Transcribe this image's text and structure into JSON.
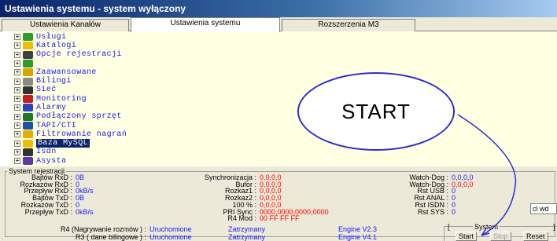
{
  "window": {
    "title": "Ustawienia systemu - system wyłączony"
  },
  "tabs": [
    {
      "label": "Ustawienia Kanałów",
      "active": false
    },
    {
      "label": "Ustawienia systemu",
      "active": true
    },
    {
      "label": "Rozszerzenia M3",
      "active": false
    }
  ],
  "tree": {
    "items": [
      {
        "label": "Usługi",
        "icon": "people-icon",
        "color": "#2e9b2e"
      },
      {
        "label": "Katalogi",
        "icon": "folder-icon",
        "color": "#e8c000"
      },
      {
        "label": "Opcje rejestracji",
        "icon": "recorder-icon",
        "color": "#404040"
      },
      {
        "label": "",
        "icon": "people-icon",
        "color": "#2e9b2e"
      },
      {
        "label": "Zaawansowane",
        "icon": "key-icon",
        "color": "#d6a500"
      },
      {
        "label": "Bilingi",
        "icon": "document-icon",
        "color": "#8a8a8a"
      },
      {
        "label": "Sieć",
        "icon": "network-icon",
        "color": "#333333"
      },
      {
        "label": "Monitoring",
        "icon": "monitor-icon",
        "color": "#c02020"
      },
      {
        "label": "Alarmy",
        "icon": "alarm-icon",
        "color": "#3040c0"
      },
      {
        "label": "Podłączony sprzęt",
        "icon": "hardware-icon",
        "color": "#1f7a1f"
      },
      {
        "label": "TAPI/CTI",
        "icon": "phone-icon",
        "color": "#2050a0"
      },
      {
        "label": "Filtrowanie nagrań",
        "icon": "filter-icon",
        "color": "#e0b000"
      },
      {
        "label": "Baza MySQL",
        "icon": "database-icon",
        "color": "#e8c000",
        "selected": true
      },
      {
        "label": "Isdn",
        "icon": "isdn-icon",
        "color": "#333333"
      },
      {
        "label": "Asysta",
        "icon": "assist-icon",
        "color": "#5a3aa0"
      }
    ]
  },
  "callout": {
    "text": "START"
  },
  "status": {
    "group_title": "System rejestracji",
    "col1": [
      {
        "label": "Bajtów RxD :",
        "value": "0B"
      },
      {
        "label": "Rozkazów RxD :",
        "value": "0"
      },
      {
        "label": "Przepływ RxD :",
        "value": "0kB/s"
      },
      {
        "label": "Bajtów TxD :",
        "value": "0B"
      },
      {
        "label": "Rozkazów TxD :",
        "value": "0"
      },
      {
        "label": "Przepływ TxD :",
        "value": "0kB/s"
      }
    ],
    "col2": [
      {
        "label": "Synchronizacja :",
        "value": "0,0,0,0"
      },
      {
        "label": "Bufor :",
        "value": "0,0,0,0"
      },
      {
        "label": "Rozkaz1 :",
        "value": "0,0,0,0"
      },
      {
        "label": "Rozkaz2 :",
        "value": "0,0,0,0"
      },
      {
        "label": "100 % :",
        "value": "0,0,0,0"
      },
      {
        "label": "PRI Sync :",
        "value": "0000,0000,0000,0000"
      },
      {
        "label": "R4 Mod :",
        "value": "00 FF FF FF"
      }
    ],
    "col3": [
      {
        "label": "Watch-Dog :",
        "value": "0,0,0,0",
        "color": "#1a1aff"
      },
      {
        "label": "Watch-Dog :",
        "value": "0,0,0,0",
        "color": "#ff0000"
      },
      {
        "label": "Rst USB :",
        "value": "0",
        "color": "#1a1aff"
      },
      {
        "label": "Rst ANAL :",
        "value": "0",
        "color": "#1a1aff"
      },
      {
        "label": "Rst ISDN :",
        "value": "0",
        "color": "#1a1aff"
      },
      {
        "label": "Rst SYS :",
        "value": "0",
        "color": "#1a1aff"
      }
    ],
    "small_field": "cl wd",
    "bottom_rows": [
      {
        "label": "R4 (Nagrywanie rozmów ) :",
        "status": "Uruchomione",
        "action": "Zatrzymany",
        "engine": "Engine V2.3"
      },
      {
        "label": "R3 ( dane bilingowe ) :",
        "status": "Uruchomione",
        "action": "Zatrzymany",
        "engine": "Engine V4.1"
      }
    ],
    "system_frame": {
      "title": "System",
      "bracket_left": "[",
      "bracket_right": "]",
      "buttons": [
        {
          "label": "Start",
          "disabled": false
        },
        {
          "label": "Stop",
          "disabled": true
        },
        {
          "label": "Reset",
          "disabled": false
        }
      ]
    }
  },
  "colors": {
    "label_blue": "#1a1aff",
    "value_red": "#ff0000",
    "title_bar": "#0a246a",
    "tree_bg": "#ffffe1",
    "callout_border": "#2d2dcf"
  }
}
